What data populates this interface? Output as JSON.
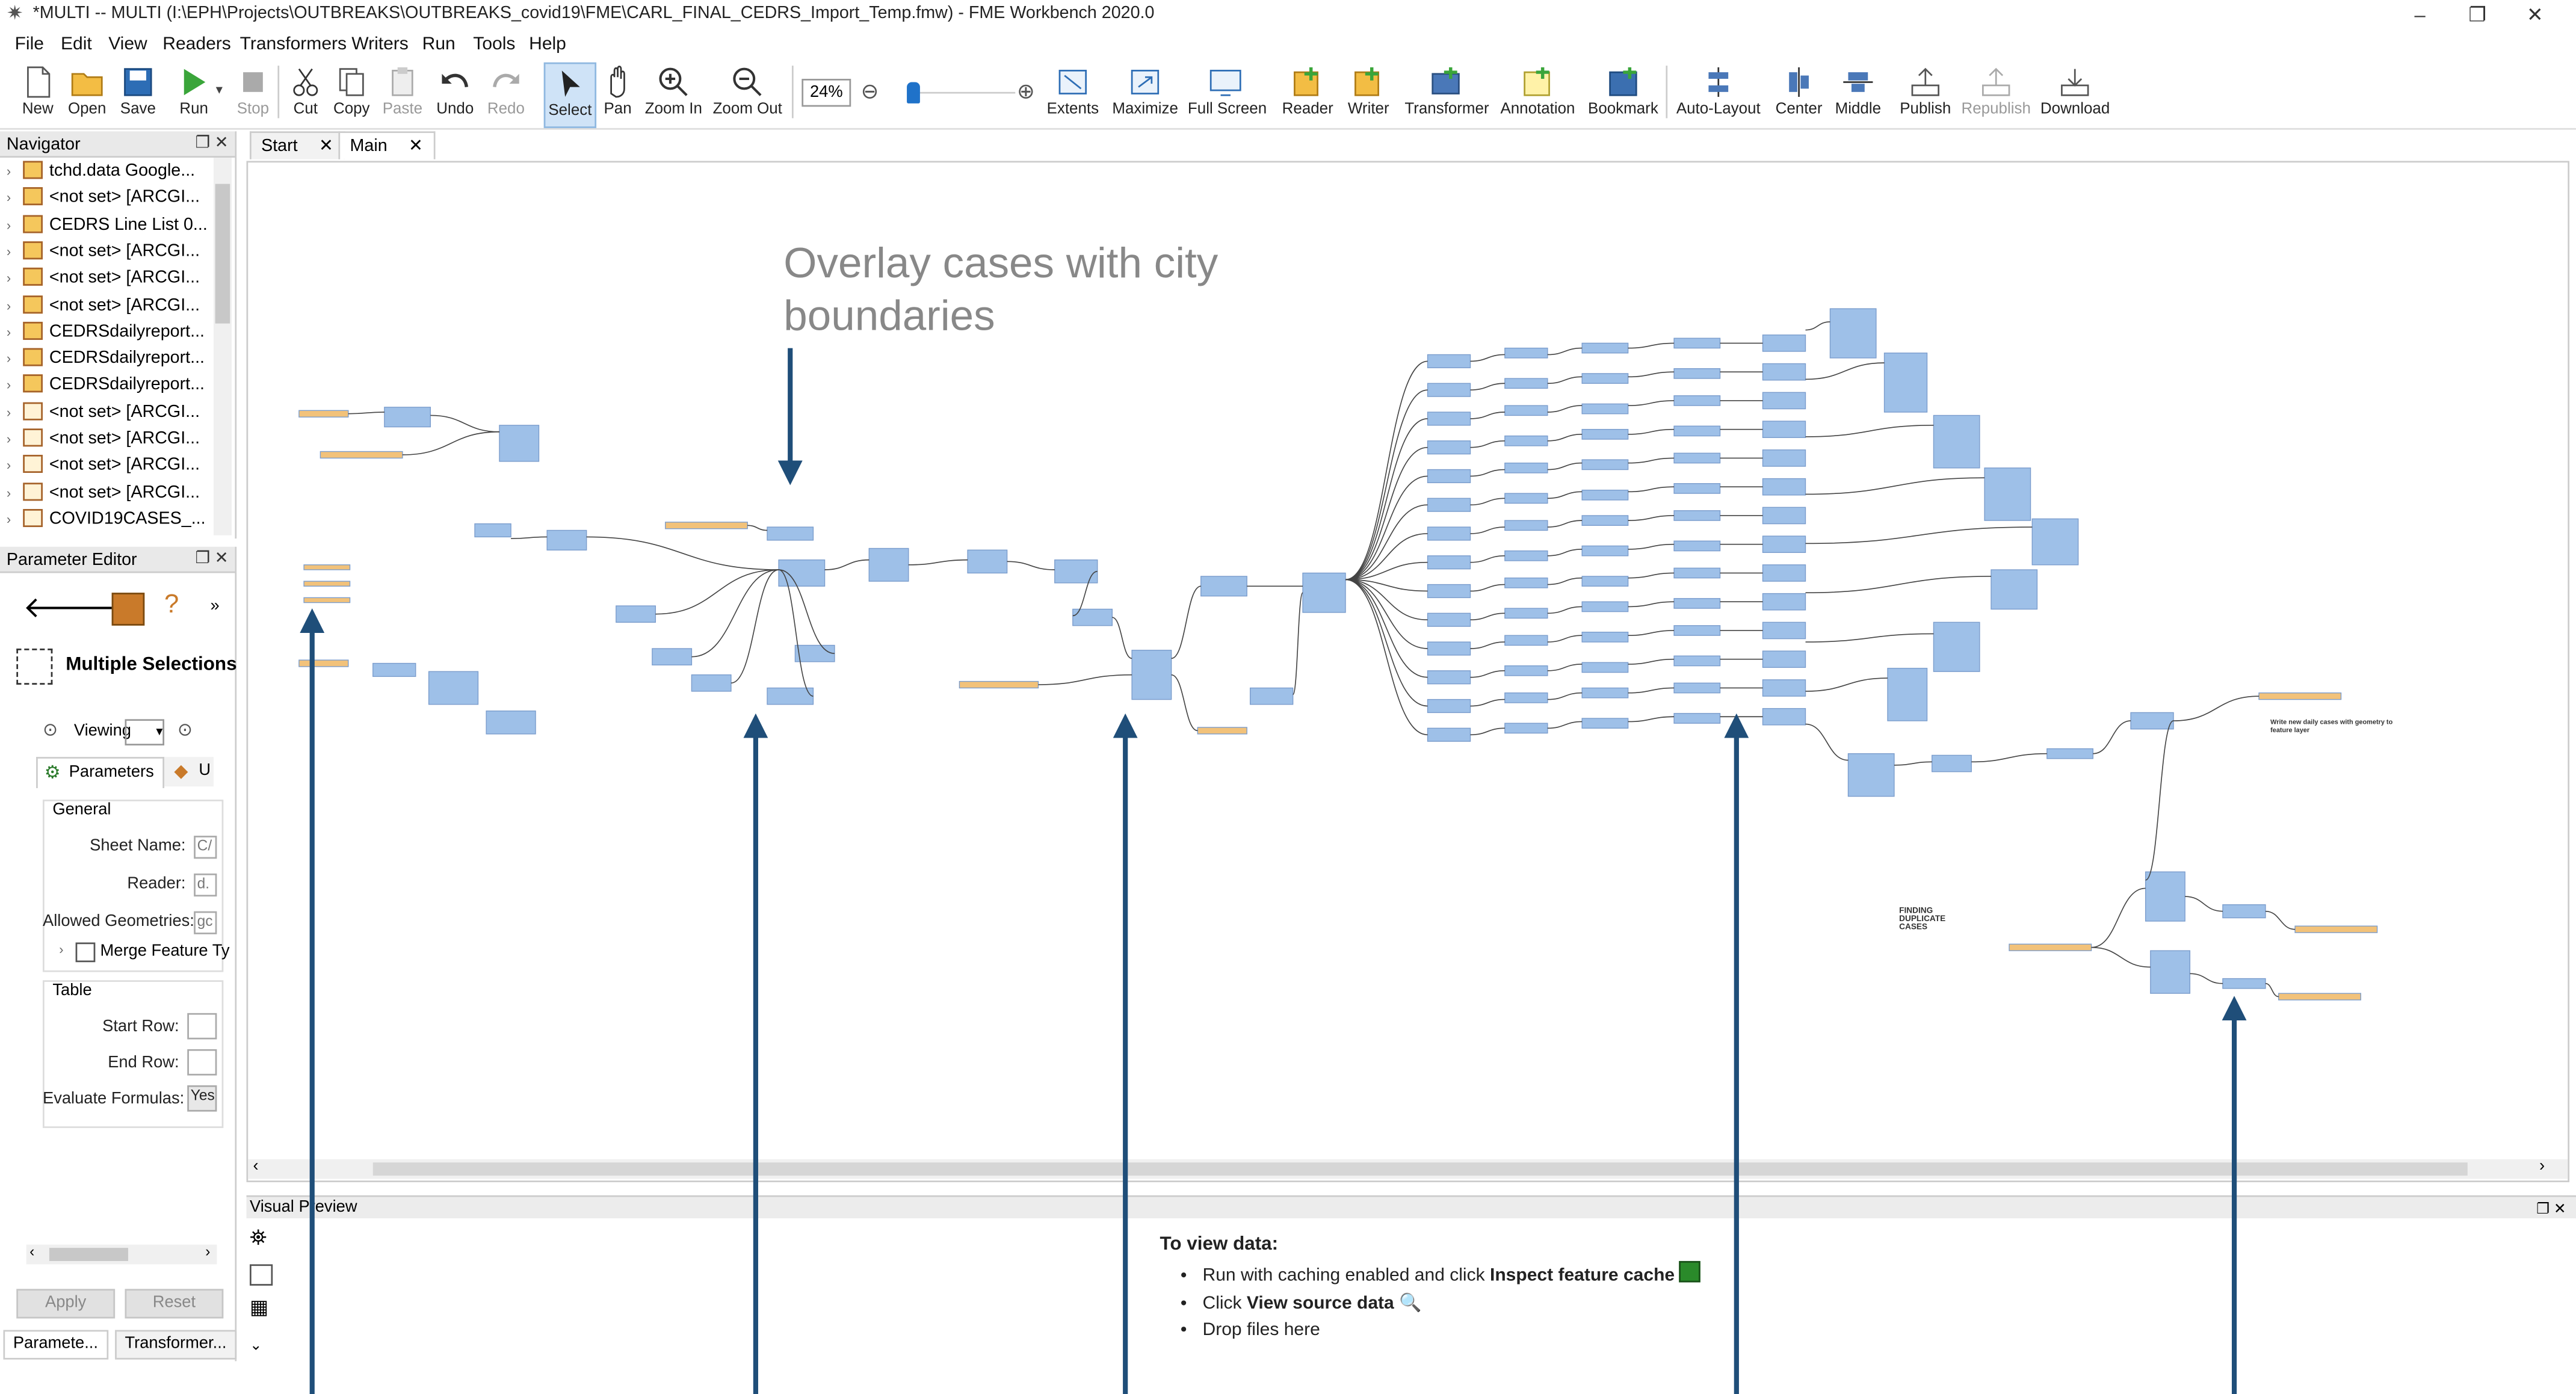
{
  "window": {
    "title": "*MULTI -- MULTI (I:\\EPH\\Projects\\OUTBREAKS\\OUTBREAKS_covid19\\FME\\CARL_FINAL_CEDRS_Import_Temp.fmw) - FME Workbench 2020.0",
    "controls": [
      "–",
      "❐",
      "✕"
    ]
  },
  "menu": [
    "File",
    "Edit",
    "View",
    "Readers",
    "Transformers",
    "Writers",
    "Run",
    "Tools",
    "Help"
  ],
  "toolbar": {
    "buttons": [
      {
        "label": "New",
        "icon": "new-file-icon"
      },
      {
        "label": "Open",
        "icon": "open-folder-icon"
      },
      {
        "label": "Save",
        "icon": "save-icon"
      },
      {
        "label": "Run",
        "icon": "run-play-icon"
      },
      {
        "label": "Stop",
        "icon": "stop-icon",
        "disabled": true
      },
      {
        "label": "Cut",
        "icon": "cut-icon"
      },
      {
        "label": "Copy",
        "icon": "copy-icon"
      },
      {
        "label": "Paste",
        "icon": "paste-icon",
        "disabled": true
      },
      {
        "label": "Undo",
        "icon": "undo-icon"
      },
      {
        "label": "Redo",
        "icon": "redo-icon",
        "disabled": true
      },
      {
        "label": "Select",
        "icon": "select-cursor-icon",
        "selected": true
      },
      {
        "label": "Pan",
        "icon": "pan-hand-icon"
      },
      {
        "label": "Zoom In",
        "icon": "zoom-in-icon"
      },
      {
        "label": "Zoom Out",
        "icon": "zoom-out-icon"
      },
      {
        "label": "Extents",
        "icon": "extents-icon"
      },
      {
        "label": "Maximize",
        "icon": "maximize-icon"
      },
      {
        "label": "Full Screen",
        "icon": "full-screen-icon"
      },
      {
        "label": "Reader",
        "icon": "reader-icon"
      },
      {
        "label": "Writer",
        "icon": "writer-icon"
      },
      {
        "label": "Transformer",
        "icon": "transformer-icon"
      },
      {
        "label": "Annotation",
        "icon": "annotation-icon"
      },
      {
        "label": "Bookmark",
        "icon": "bookmark-icon"
      },
      {
        "label": "Auto-Layout",
        "icon": "auto-layout-icon"
      },
      {
        "label": "Center",
        "icon": "center-icon"
      },
      {
        "label": "Middle",
        "icon": "middle-icon"
      },
      {
        "label": "Publish",
        "icon": "publish-icon"
      },
      {
        "label": "Republish",
        "icon": "republish-icon",
        "disabled": true
      },
      {
        "label": "Download",
        "icon": "download-icon"
      }
    ],
    "zoom": "24%",
    "zoom_level_fraction": 0.05
  },
  "navigator": {
    "title": "Navigator",
    "items": [
      {
        "label": "tchd.data Google...",
        "kind": "reader"
      },
      {
        "label": "<not set> [ARCGI...",
        "kind": "reader"
      },
      {
        "label": "CEDRS Line List 0...",
        "kind": "reader"
      },
      {
        "label": "<not set> [ARCGI...",
        "kind": "reader"
      },
      {
        "label": "<not set> [ARCGI...",
        "kind": "reader"
      },
      {
        "label": "<not set> [ARCGI...",
        "kind": "reader"
      },
      {
        "label": "CEDRSdailyreport...",
        "kind": "reader"
      },
      {
        "label": "CEDRSdailyreport...",
        "kind": "reader"
      },
      {
        "label": "CEDRSdailyreport...",
        "kind": "reader"
      },
      {
        "label": "<not set> [ARCGI...",
        "kind": "writer"
      },
      {
        "label": "<not set> [ARCGI...",
        "kind": "writer"
      },
      {
        "label": "<not set> [ARCGI...",
        "kind": "writer"
      },
      {
        "label": "<not set> [ARCGI...",
        "kind": "writer"
      },
      {
        "label": "COVID19CASES_...",
        "kind": "writer"
      }
    ]
  },
  "parameter_editor": {
    "title": "Parameter Editor",
    "selection": "Multiple Selections",
    "viewing_label": "Viewing",
    "tabs": [
      "Parameters",
      "U"
    ],
    "general_title": "General",
    "fields": [
      {
        "label": "Sheet Name:",
        "value": "C/"
      },
      {
        "label": "Reader:",
        "value": "d."
      },
      {
        "label": "Allowed Geometries:",
        "value": "gc"
      }
    ],
    "merge_label": "Merge Feature Ty",
    "table_title": "Table",
    "table_fields": [
      {
        "label": "Start Row:",
        "value": ""
      },
      {
        "label": "End Row:",
        "value": ""
      },
      {
        "label": "Evaluate Formulas:",
        "value": "Yes"
      }
    ],
    "apply": "Apply",
    "reset": "Reset"
  },
  "tabs": [
    {
      "label": "Start",
      "active": false
    },
    {
      "label": "Main",
      "active": true
    }
  ],
  "canvas": {
    "annotation": "Overlay cases with city boundaries",
    "bookmark_texts": [
      "FINDING DUPLICATE CASES",
      "Write new daily cases with geometry to feature layer"
    ]
  },
  "visual_preview": {
    "title": "Visual Preview",
    "heading": "To view data:",
    "items": [
      {
        "pre": "Run with caching enabled and click ",
        "bold": "Inspect feature cache"
      },
      {
        "pre": "Click ",
        "bold": "View source data"
      },
      {
        "pre": "Drop files here",
        "bold": ""
      }
    ]
  },
  "bottom_tabs": [
    "Paramete...",
    "Transformer..."
  ]
}
